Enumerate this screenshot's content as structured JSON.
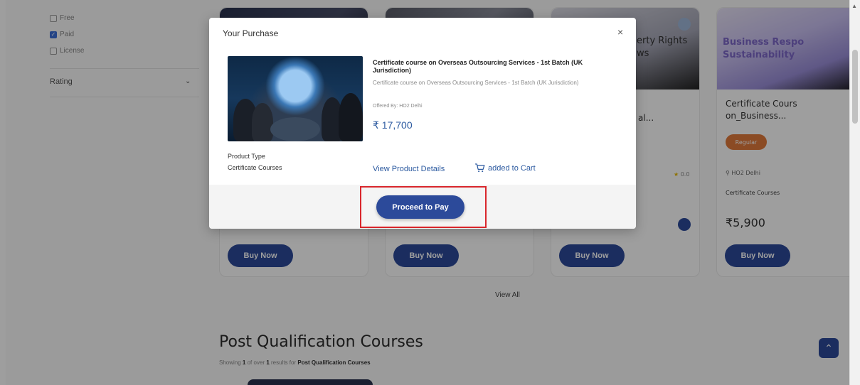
{
  "filters": {
    "type_options": [
      {
        "label": "Free",
        "checked": false
      },
      {
        "label": "Paid",
        "checked": true
      },
      {
        "label": "License",
        "checked": false
      }
    ],
    "rating_label": "Rating"
  },
  "cards": [
    {
      "buy_label": "Buy Now"
    },
    {
      "buy_label": "Buy Now"
    },
    {
      "image_text": "erty Rights\nws",
      "title_fragment": "al...",
      "rating": "0.0",
      "buy_label": "Buy Now"
    },
    {
      "image_text": "Business Respo\nSustainability",
      "title": "Certificate Cours\non_Business...",
      "badge": "Regular",
      "offered_by": "HO2 Delhi",
      "category": "Certificate Courses",
      "price": "₹5,900",
      "buy_label": "Buy Now"
    }
  ],
  "view_all": "View All",
  "section": {
    "title": "Post Qualification Courses",
    "subtitle_prefix": "Showing",
    "subtitle_count": "1",
    "subtitle_mid": "of over",
    "subtitle_total": "1",
    "subtitle_suffix": "results for",
    "subtitle_category": "Post Qualification Courses"
  },
  "modal": {
    "title": "Your Purchase",
    "close_symbol": "×",
    "product": {
      "title": "Certificate course on Overseas Outsourcing Services - 1st Batch (UK Jurisdiction)",
      "description": "Certificate course on Overseas Outsourcing Services - 1st Batch (UK Jurisdiction)",
      "offered_by": "Offered By: HO2 Delhi",
      "price": "₹ 17,700"
    },
    "product_type_label": "Product Type",
    "product_type_value": "Certificate Courses",
    "view_details_label": "View Product Details",
    "added_to_cart_label": "added to Cart",
    "proceed_label": "Proceed to Pay"
  },
  "scroll_top_symbol": "⌃",
  "colors": {
    "primary": "#2c4a9a",
    "link": "#2c5aa0",
    "highlight": "#d9262c",
    "badge": "#e07a3a"
  }
}
